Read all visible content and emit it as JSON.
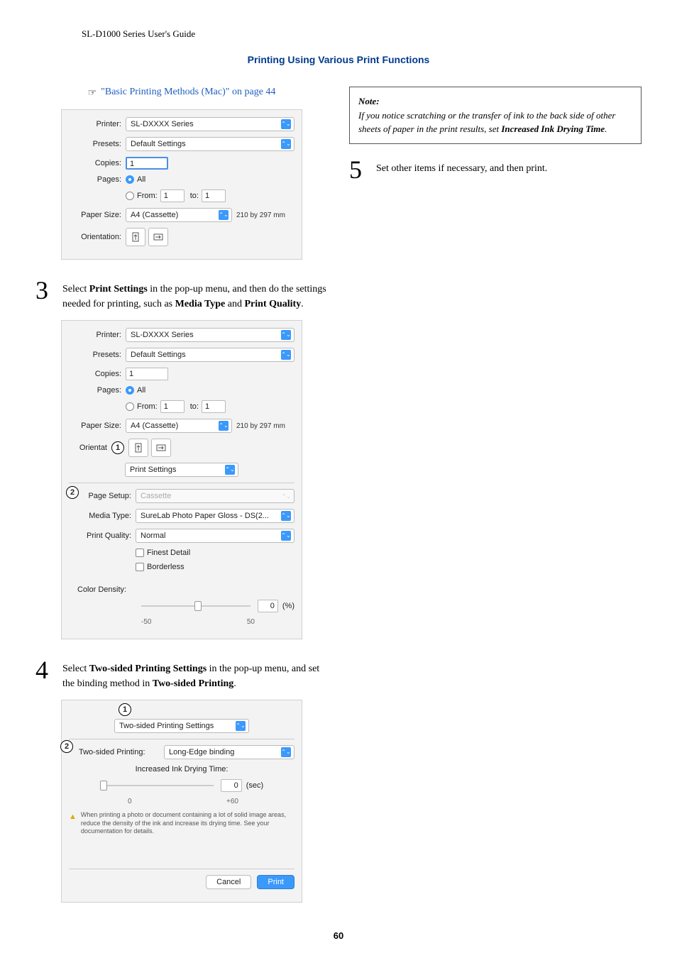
{
  "header": {
    "doc_title": "SL-D1000 Series User's Guide"
  },
  "section": {
    "title": "Printing Using Various Print Functions"
  },
  "link": {
    "icon": "☞",
    "text": "\"Basic Printing Methods (Mac)\" on page 44"
  },
  "steps": {
    "s3": {
      "num": "3",
      "text_prefix": "Select ",
      "b1": "Print Settings",
      "text_mid": " in the pop-up menu, and then do the settings needed for printing, such as ",
      "b2": "Media Type",
      "text_and": " and ",
      "b3": "Print Quality",
      "text_suffix": "."
    },
    "s4": {
      "num": "4",
      "text_prefix": "Select ",
      "b1": "Two-sided Printing Settings",
      "text_mid": " in the pop-up menu, and set the binding method in ",
      "b2": "Two-sided Printing",
      "text_suffix": "."
    },
    "s5": {
      "num": "5",
      "text": "Set other items if necessary, and then print."
    }
  },
  "note": {
    "title": "Note:",
    "text_prefix": "If you notice scratching or the transfer of ink to the back side of other sheets of paper in the print results, set ",
    "b1": "Increased Ink Drying Time",
    "text_suffix": "."
  },
  "dlg1": {
    "printer_lbl": "Printer:",
    "printer_val": "SL-DXXXX Series",
    "presets_lbl": "Presets:",
    "presets_val": "Default Settings",
    "copies_lbl": "Copies:",
    "copies_val": "1",
    "pages_lbl": "Pages:",
    "pages_all": "All",
    "from_lbl": "From:",
    "from_val": "1",
    "to_lbl": "to:",
    "to_val": "1",
    "papersize_lbl": "Paper Size:",
    "papersize_val": "A4 (Cassette)",
    "papersize_dim": "210 by 297 mm",
    "orientation_lbl": "Orientation:"
  },
  "dlg2": {
    "printer_lbl": "Printer:",
    "printer_val": "SL-DXXXX Series",
    "presets_lbl": "Presets:",
    "presets_val": "Default Settings",
    "copies_lbl": "Copies:",
    "copies_val": "1",
    "pages_lbl": "Pages:",
    "pages_all": "All",
    "from_lbl": "From:",
    "from_val": "1",
    "to_lbl": "to:",
    "to_val": "1",
    "papersize_lbl": "Paper Size:",
    "papersize_val": "A4 (Cassette)",
    "papersize_dim": "210 by 297 mm",
    "orientat_lbl": "Orientat",
    "popup_val": "Print Settings",
    "page_setup_lbl": "Page Setup:",
    "page_setup_val": "Cassette",
    "media_type_lbl": "Media Type:",
    "media_type_val": "SureLab Photo Paper Gloss - DS(2...",
    "print_quality_lbl": "Print Quality:",
    "print_quality_val": "Normal",
    "finest_detail": "Finest Detail",
    "borderless": "Borderless",
    "color_density_lbl": "Color Density:",
    "density_val": "0",
    "density_unit": "(%)",
    "density_min": "-50",
    "density_max": "50",
    "callout1": "1",
    "callout2": "2"
  },
  "dlg3": {
    "popup_val": "Two-sided Printing Settings",
    "twosided_lbl": "Two-sided Printing:",
    "twosided_val": "Long-Edge binding",
    "drying_lbl": "Increased Ink Drying Time:",
    "drying_val": "0",
    "drying_unit": "(sec)",
    "drying_min": "0",
    "drying_max": "+60",
    "info_text": "When printing a photo or document containing a lot of solid image areas, reduce the density of the ink and increase its drying time. See your documentation for details.",
    "cancel": "Cancel",
    "print": "Print",
    "callout1": "1",
    "callout2": "2",
    "info_icon": "▲"
  },
  "footer": {
    "page_number": "60"
  }
}
